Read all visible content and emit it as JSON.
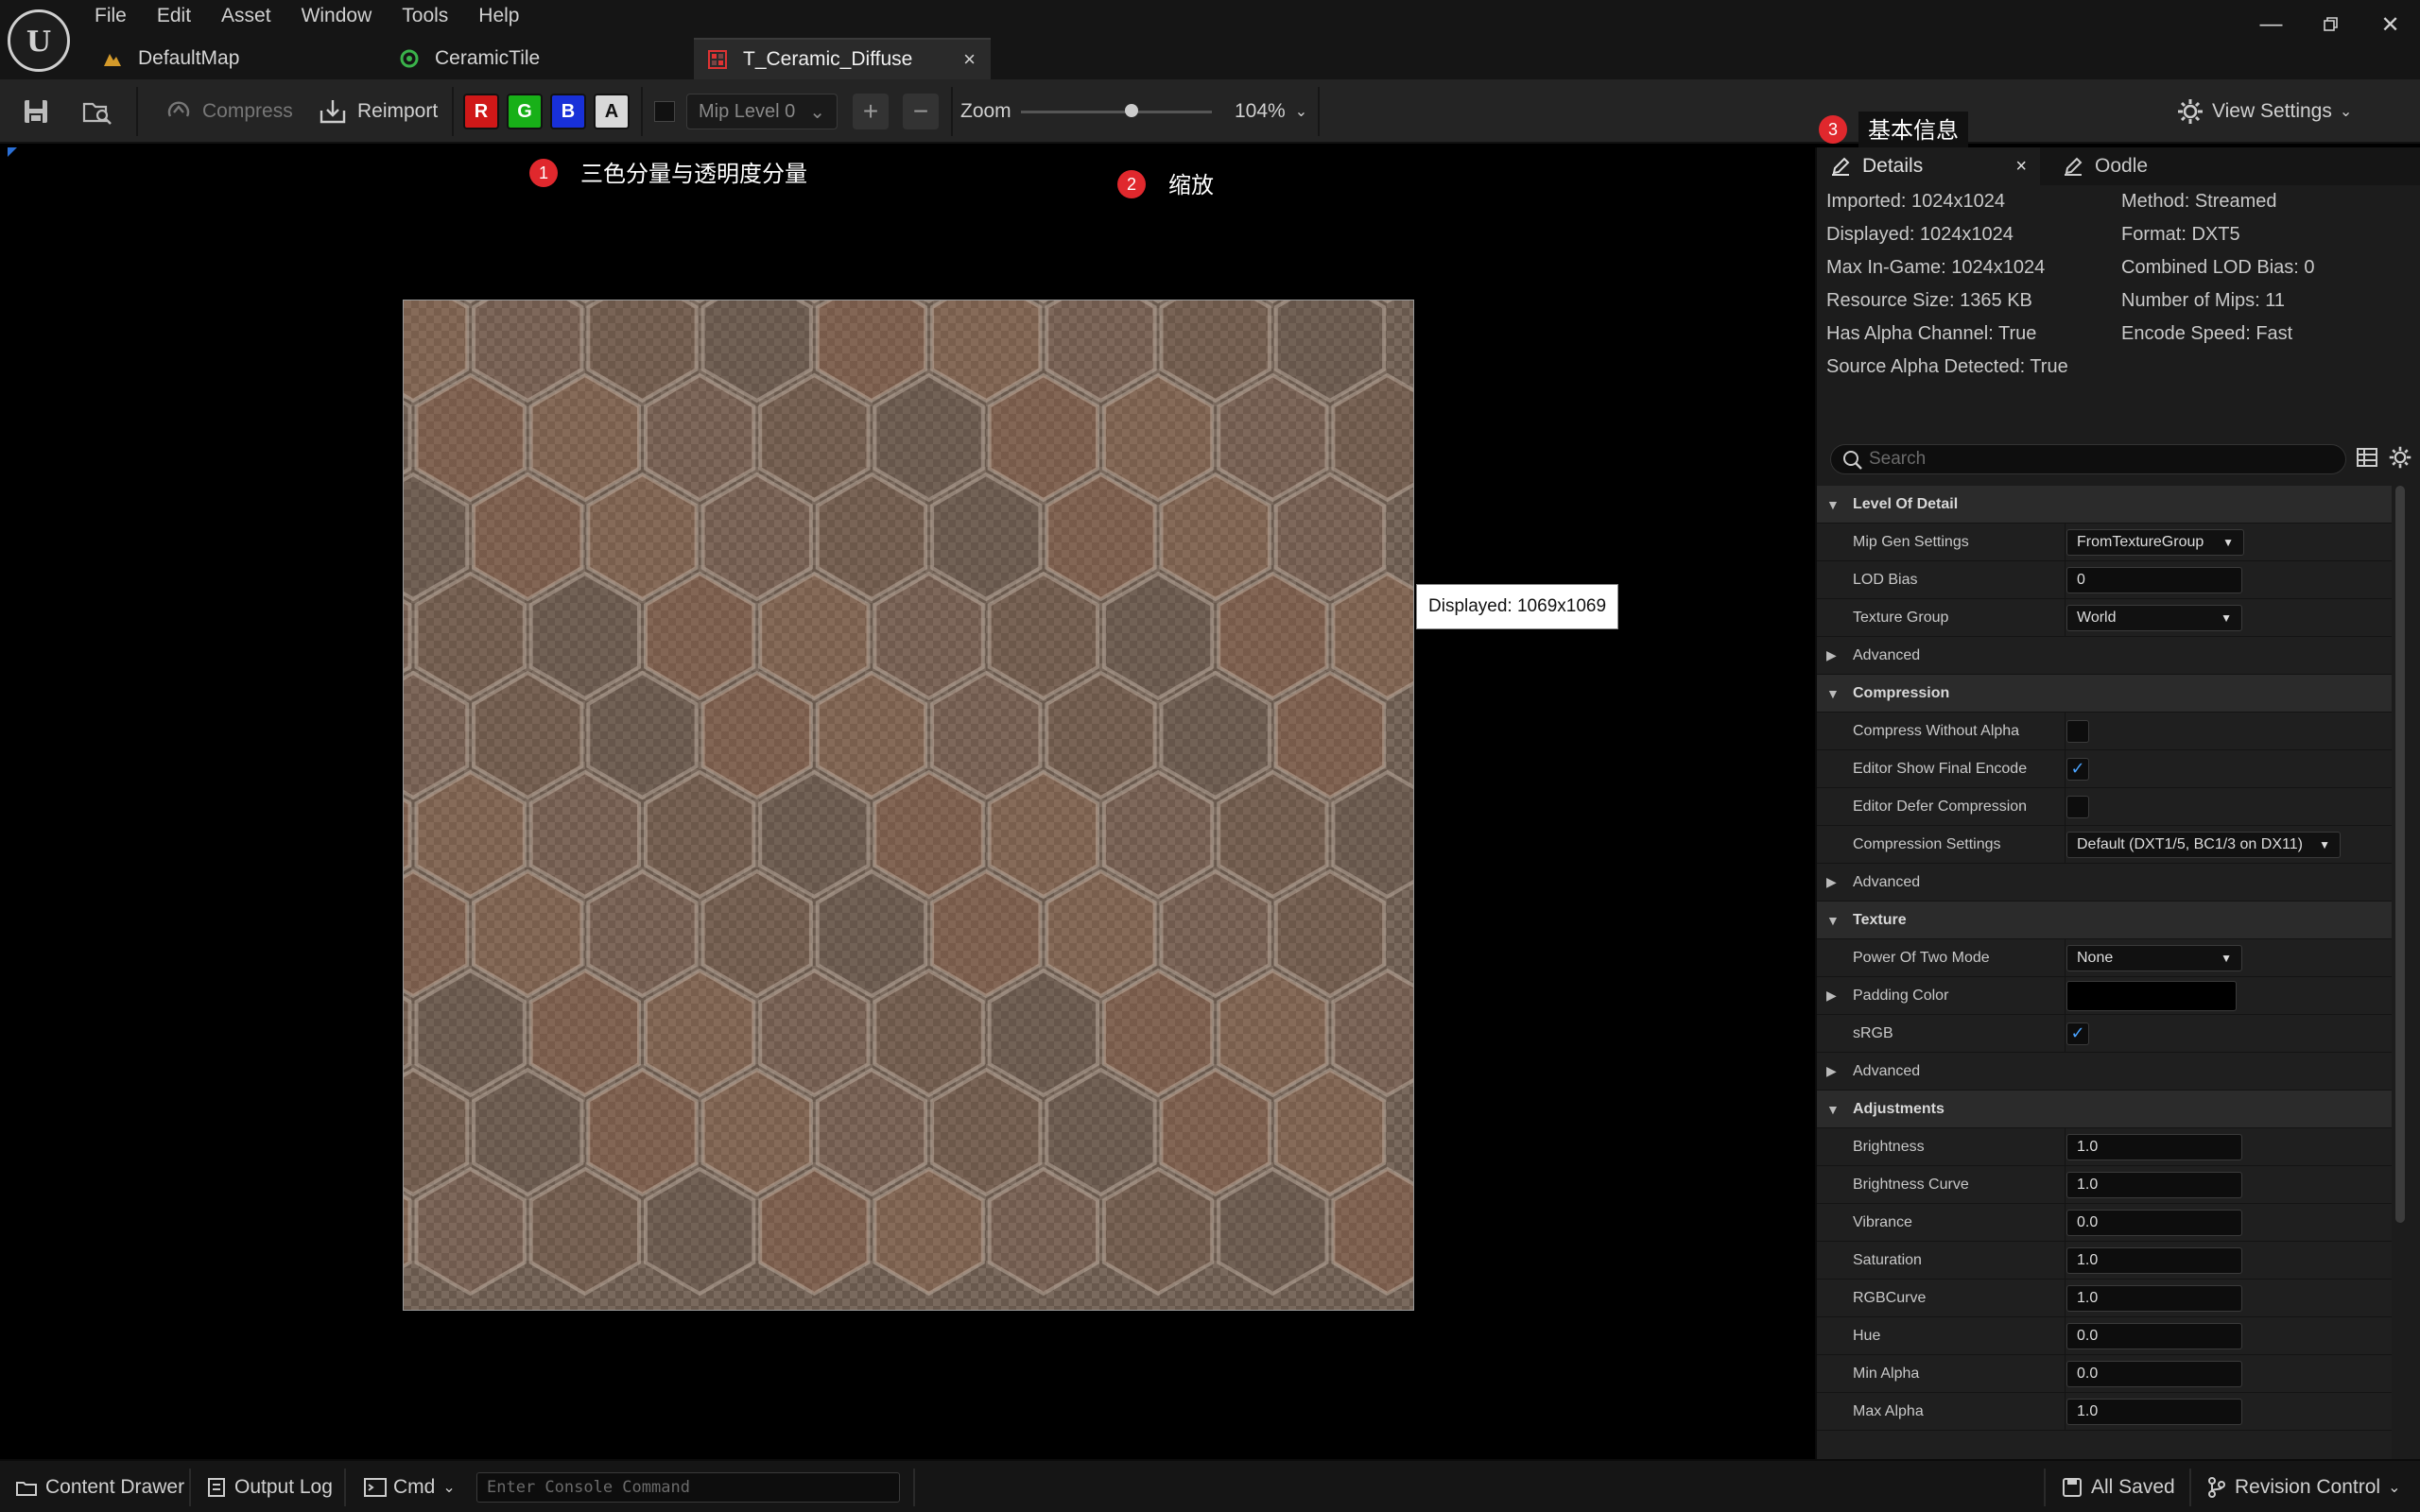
{
  "menu": [
    "File",
    "Edit",
    "Asset",
    "Window",
    "Tools",
    "Help"
  ],
  "tabs": [
    {
      "label": "DefaultMap",
      "icon": "level-icon"
    },
    {
      "label": "CeramicTile",
      "icon": "material-icon"
    },
    {
      "label": "T_Ceramic_Diffuse",
      "icon": "texture-icon",
      "active": true
    }
  ],
  "toolbar": {
    "compress_label": "Compress",
    "reimport_label": "Reimport",
    "channels": [
      {
        "label": "R",
        "color": "#d01818"
      },
      {
        "label": "G",
        "color": "#18b018"
      },
      {
        "label": "B",
        "color": "#1830d8"
      },
      {
        "label": "A",
        "color": "#d8d8d8"
      }
    ],
    "mip_level": "Mip Level 0",
    "zoom_label": "Zoom",
    "zoom_value": "104%",
    "zoom_level": 0.58,
    "view_settings": "View Settings"
  },
  "viewport": {
    "displayed_tooltip": "Displayed: 1069x1069"
  },
  "callouts": [
    {
      "num": "1",
      "text": "三色分量与透明度分量"
    },
    {
      "num": "2",
      "text": "缩放"
    },
    {
      "num": "3",
      "text": "基本信息"
    }
  ],
  "panel": {
    "tab_details": "Details",
    "tab_oodle": "Oodle",
    "info_left": [
      "Imported: 1024x1024",
      "Displayed: 1024x1024",
      "Max In-Game: 1024x1024",
      "Resource Size: 1365 KB",
      "Has Alpha Channel: True",
      "Source Alpha Detected: True"
    ],
    "info_right": [
      "Method: Streamed",
      "Format: DXT5",
      "Combined LOD Bias: 0",
      "Number of Mips: 11",
      "Encode Speed: Fast"
    ],
    "search_placeholder": "Search",
    "sections": {
      "lod": "Level Of Detail",
      "mip_gen": "Mip Gen Settings",
      "mip_gen_value": "FromTextureGroup",
      "lod_bias": "LOD Bias",
      "lod_bias_value": "0",
      "texture_group": "Texture Group",
      "texture_group_value": "World",
      "advanced": "Advanced",
      "compression": "Compression",
      "compress_without_alpha": "Compress Without Alpha",
      "editor_show_final_encode": "Editor Show Final Encode",
      "editor_defer_compression": "Editor Defer Compression",
      "compression_settings": "Compression Settings",
      "compression_settings_value": "Default (DXT1/5, BC1/3 on DX11)",
      "texture": "Texture",
      "power_of_two": "Power Of Two Mode",
      "power_of_two_value": "None",
      "padding_color": "Padding Color",
      "srgb": "sRGB",
      "adjustments": "Adjustments",
      "brightness": "Brightness",
      "brightness_value": "1.0",
      "brightness_curve": "Brightness Curve",
      "brightness_curve_value": "1.0",
      "vibrance": "Vibrance",
      "vibrance_value": "0.0",
      "saturation": "Saturation",
      "saturation_value": "1.0",
      "rgbcurve": "RGBCurve",
      "rgbcurve_value": "1.0",
      "hue": "Hue",
      "hue_value": "0.0",
      "min_alpha": "Min Alpha",
      "min_alpha_value": "0.0",
      "max_alpha": "Max Alpha",
      "max_alpha_value": "1.0"
    }
  },
  "statusbar": {
    "content_drawer": "Content Drawer",
    "output_log": "Output Log",
    "cmd": "Cmd",
    "console_placeholder": "Enter Console Command",
    "all_saved": "All Saved",
    "revision_control": "Revision Control"
  }
}
